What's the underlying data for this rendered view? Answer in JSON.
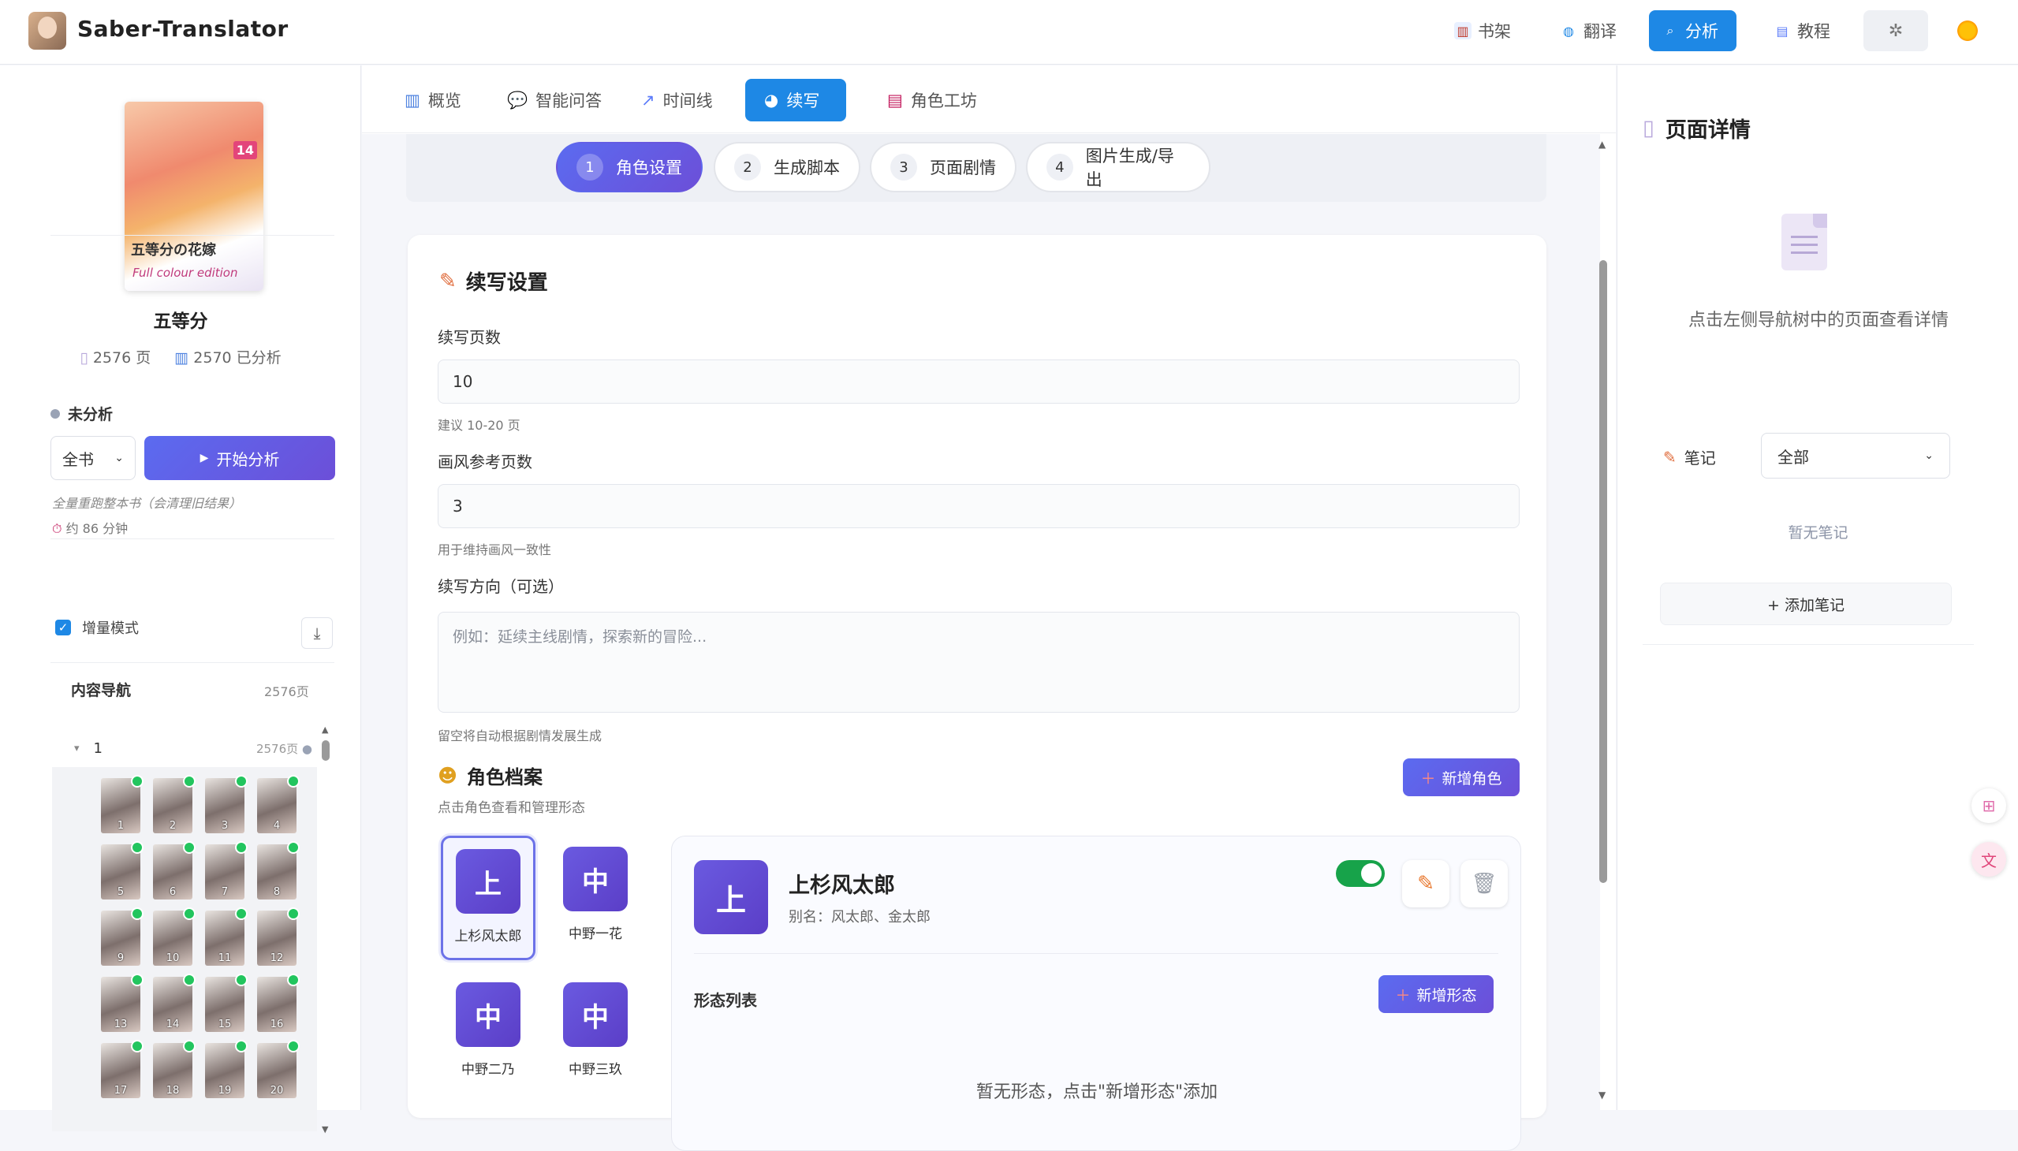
{
  "app": {
    "title": "Saber-Translator"
  },
  "topnav": [
    {
      "label": "书架",
      "icon": "books-icon"
    },
    {
      "label": "翻译",
      "icon": "globe-icon"
    },
    {
      "label": "分析",
      "icon": "search-icon",
      "active": true
    },
    {
      "label": "教程",
      "icon": "book-icon"
    }
  ],
  "book": {
    "cover_title": "五等分の花嫁",
    "cover_subtitle": "Full colour edition",
    "cover_volume": "14",
    "title": "五等分",
    "pages": "2576 页",
    "analyzed": "2570 已分析"
  },
  "analysis": {
    "status": "未分析",
    "scope": "全书",
    "start_label": "开始分析",
    "hint": "全量重跑整本书（会清理旧结果）",
    "eta": "约 86 分钟",
    "incremental_label": "增量模式"
  },
  "content_nav": {
    "title": "内容导航",
    "count": "2576页",
    "node_label": "1",
    "node_count": "2576页",
    "thumbs": [
      "1",
      "2",
      "3",
      "4",
      "5",
      "6",
      "7",
      "8",
      "9",
      "10",
      "11",
      "12",
      "13",
      "14",
      "15",
      "16",
      "17",
      "18",
      "19",
      "20"
    ]
  },
  "tabs": [
    {
      "label": "概览",
      "icon": "chart-icon"
    },
    {
      "label": "智能问答",
      "icon": "chat-icon"
    },
    {
      "label": "时间线",
      "icon": "timeline-icon"
    },
    {
      "label": "续写",
      "icon": "palette-icon",
      "active": true
    },
    {
      "label": "角色工坊",
      "icon": "card-icon"
    }
  ],
  "steps": [
    {
      "num": "1",
      "label": "角色设置",
      "active": true
    },
    {
      "num": "2",
      "label": "生成脚本"
    },
    {
      "num": "3",
      "label": "页面剧情"
    },
    {
      "num": "4",
      "label": "图片生成/导出"
    }
  ],
  "settings": {
    "title": "续写设置",
    "pages_label": "续写页数",
    "pages_value": "10",
    "pages_hint": "建议 10-20 页",
    "ref_label": "画风参考页数",
    "ref_value": "3",
    "ref_hint": "用于维持画风一致性",
    "direction_label": "续写方向（可选）",
    "direction_placeholder": "例如：延续主线剧情，探索新的冒险...",
    "direction_hint": "留空将自动根据剧情发展生成"
  },
  "characters": {
    "title": "角色档案",
    "subtitle": "点击角色查看和管理形态",
    "add_label": "新增角色",
    "list": [
      {
        "avatar": "上",
        "name": "上杉风太郎",
        "selected": true
      },
      {
        "avatar": "中",
        "name": "中野一花"
      },
      {
        "avatar": "中",
        "name": "中野二乃"
      },
      {
        "avatar": "中",
        "name": "中野三玖"
      }
    ],
    "detail": {
      "avatar": "上",
      "name": "上杉风太郎",
      "alias": "别名：风太郎、金太郎",
      "enabled": true,
      "forms_label": "形态列表",
      "add_form_label": "新增形态",
      "empty": "暂无形态，点击\"新增形态\"添加"
    }
  },
  "page_detail": {
    "title": "页面详情",
    "message": "点击左侧导航树中的页面查看详情",
    "notes_label": "笔记",
    "notes_filter": "全部",
    "no_notes": "暂无笔记",
    "add_note": "+ 添加笔记"
  },
  "colors": {
    "accent": "#1e88e5",
    "primary_gradient": "#5b6bf0",
    "success": "#22c55e"
  }
}
